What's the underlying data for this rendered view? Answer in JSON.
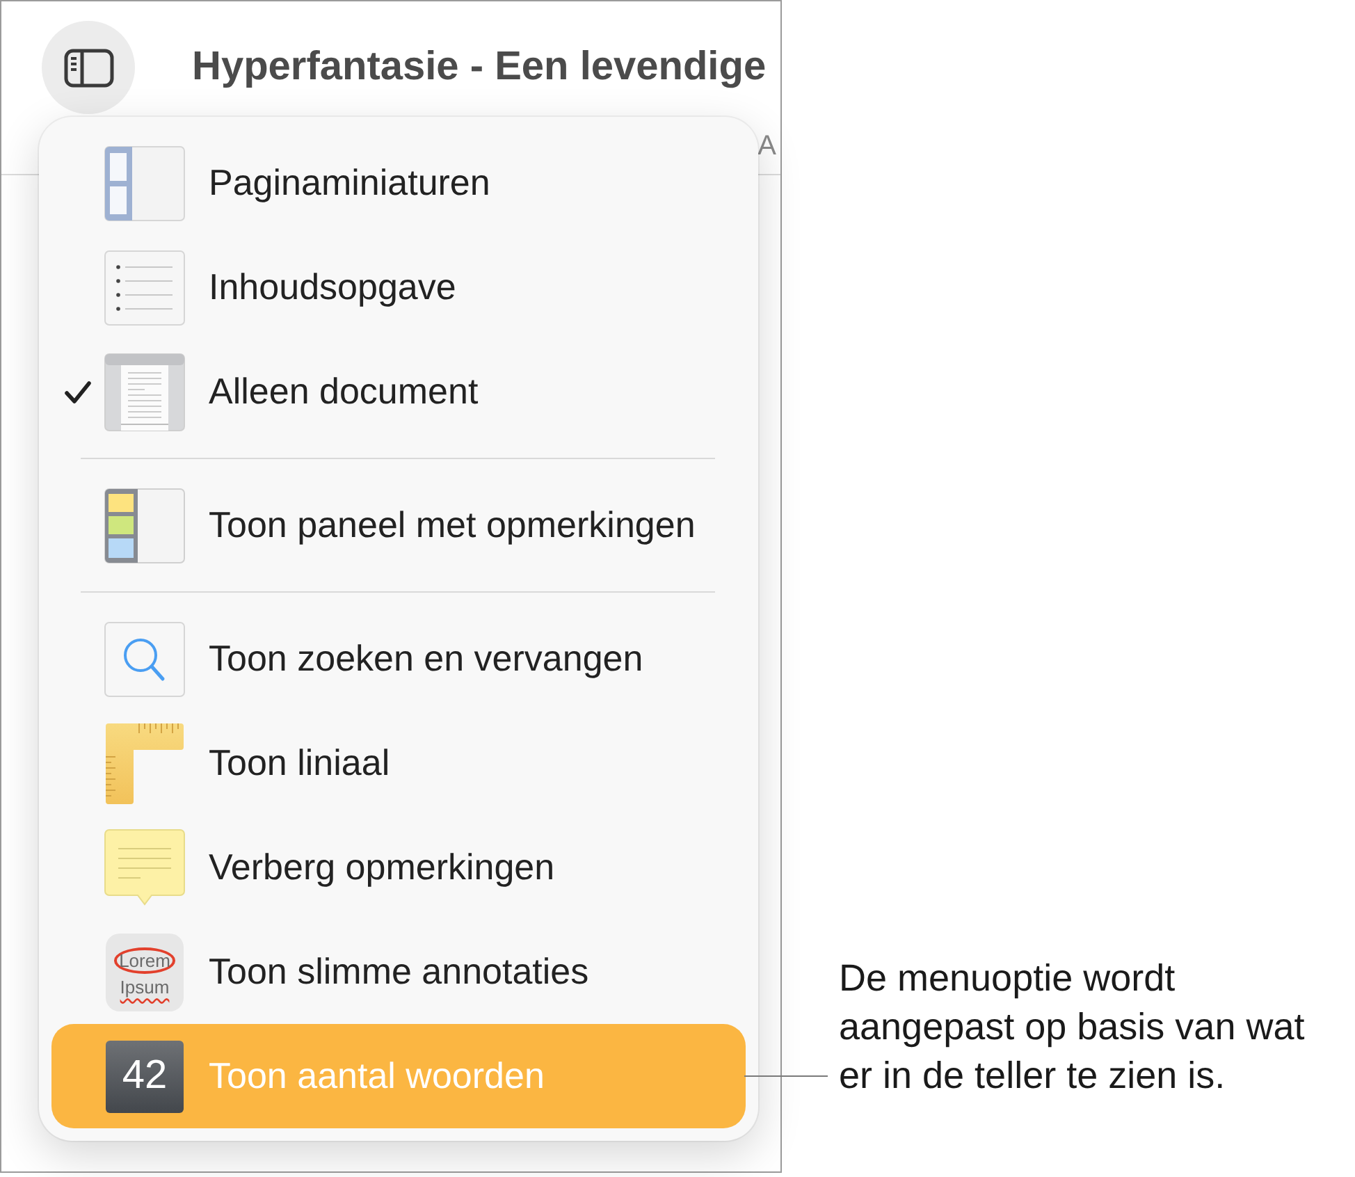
{
  "toolbar": {
    "title": "Hyperfantasie - Een levendige",
    "cut_label": "A"
  },
  "menu": {
    "sections": [
      {
        "items": [
          {
            "label": "Paginaminiaturen",
            "checked": false,
            "selected": false
          },
          {
            "label": "Inhoudsopgave",
            "checked": false,
            "selected": false
          },
          {
            "label": "Alleen document",
            "checked": true,
            "selected": false
          }
        ]
      },
      {
        "items": [
          {
            "label": "Toon paneel met opmerkingen",
            "checked": false,
            "selected": false
          }
        ]
      },
      {
        "items": [
          {
            "label": "Toon zoeken en vervangen",
            "checked": false,
            "selected": false
          },
          {
            "label": "Toon liniaal",
            "checked": false,
            "selected": false
          },
          {
            "label": "Verberg opmerkingen",
            "checked": false,
            "selected": false
          },
          {
            "label": "Toon slimme annotaties",
            "checked": false,
            "selected": false,
            "icon_text": [
              "Lorem",
              "Ipsum"
            ]
          },
          {
            "label": "Toon aantal woorden",
            "checked": false,
            "selected": true,
            "icon_text": [
              "42"
            ]
          }
        ]
      }
    ]
  },
  "callout": {
    "text": "De menuoptie wordt aangepast op basis van wat er in de teller te zien is."
  }
}
